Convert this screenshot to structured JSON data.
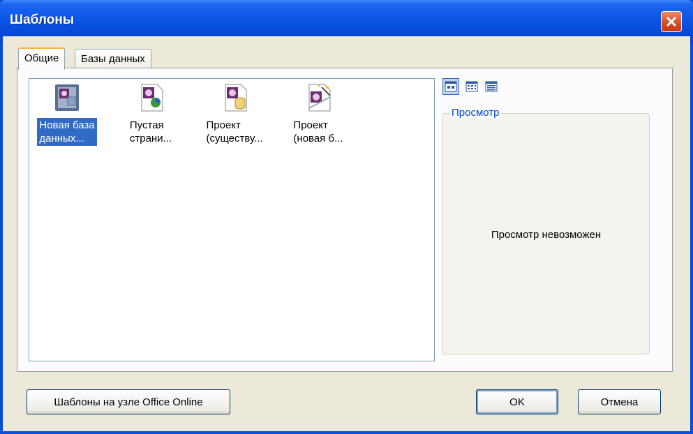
{
  "window": {
    "title": "Шаблоны"
  },
  "tabs": [
    {
      "label": "Общие",
      "active": true
    },
    {
      "label": "Базы данных",
      "active": false
    }
  ],
  "templates": [
    {
      "line1": "Новая база",
      "line2": "данных...",
      "icon": "new-database-icon",
      "selected": true
    },
    {
      "line1": "Пустая",
      "line2": "страни...",
      "icon": "blank-page-icon",
      "selected": false
    },
    {
      "line1": "Проект",
      "line2": "(существу...",
      "icon": "project-existing-data-icon",
      "selected": false
    },
    {
      "line1": "Проект",
      "line2": "(новая б...",
      "icon": "project-new-data-icon",
      "selected": false
    }
  ],
  "view_buttons": [
    "large-icons-view-icon",
    "list-view-icon",
    "details-view-icon"
  ],
  "preview": {
    "title": "Просмотр",
    "message": "Просмотр невозможен"
  },
  "buttons": {
    "office_online": "Шаблоны на узле Office Online",
    "ok": "OK",
    "cancel": "Отмена"
  },
  "colors": {
    "titlebar": "#0a55e6",
    "selection": "#316ac5",
    "group_title": "#0046d5",
    "close_button": "#d64a22"
  }
}
